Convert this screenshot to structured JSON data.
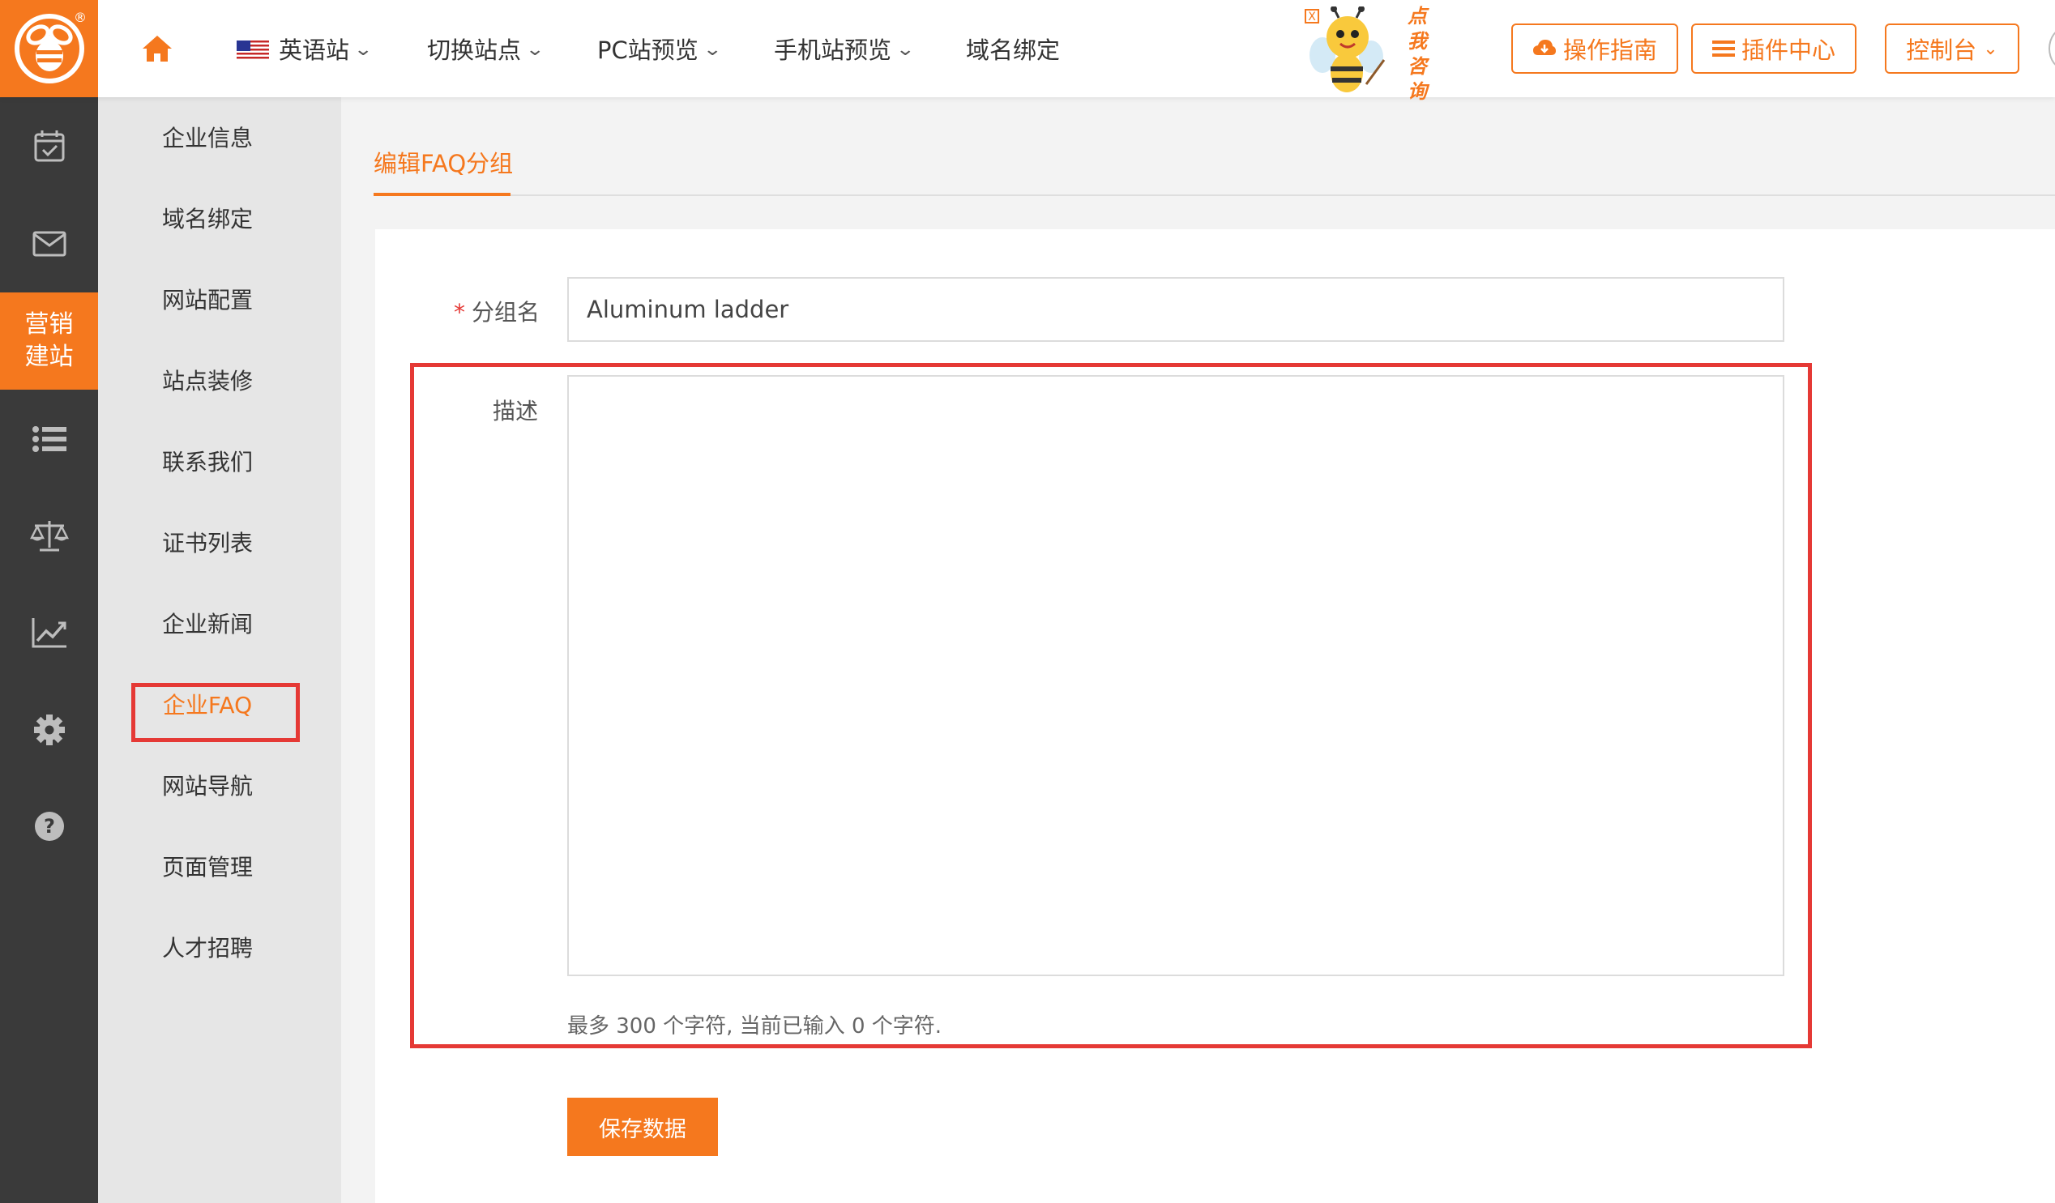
{
  "topbar": {
    "nav": [
      {
        "label": "英语站",
        "has_dropdown": true,
        "flag": "us-flag-icon"
      },
      {
        "label": "切换站点",
        "has_dropdown": true
      },
      {
        "label": "PC站预览",
        "has_dropdown": true
      },
      {
        "label": "手机站预览",
        "has_dropdown": true
      },
      {
        "label": "域名绑定",
        "has_dropdown": false
      }
    ],
    "mascot_text": [
      "点",
      "我",
      "咨",
      "询"
    ],
    "mascot_close": "X",
    "buttons": {
      "guide": "操作指南",
      "plugins": "插件中心",
      "console": "控制台"
    }
  },
  "iconbar": {
    "items": [
      "calendar-check-icon",
      "mail-icon",
      "marketing-site",
      "list-icon",
      "scale-icon",
      "chart-icon",
      "gear-icon",
      "help-icon"
    ],
    "active_label_line1": "营销",
    "active_label_line2": "建站"
  },
  "submenu": {
    "items": [
      {
        "label": "企业信息"
      },
      {
        "label": "域名绑定"
      },
      {
        "label": "网站配置"
      },
      {
        "label": "站点装修"
      },
      {
        "label": "联系我们"
      },
      {
        "label": "证书列表"
      },
      {
        "label": "企业新闻"
      },
      {
        "label": "企业FAQ",
        "active": true
      },
      {
        "label": "网站导航"
      },
      {
        "label": "页面管理"
      },
      {
        "label": "人才招聘"
      }
    ]
  },
  "main": {
    "tab_title": "编辑FAQ分组",
    "form": {
      "group_name_label": "分组名",
      "required_mark": "*",
      "group_name_value": "Aluminum ladder",
      "description_label": "描述",
      "description_value": "",
      "hint": "最多 300 个字符, 当前已输入 0 个字符.",
      "save_label": "保存数据"
    }
  },
  "colors": {
    "accent": "#f5781e",
    "sidebar_dark": "#3a3a3a",
    "highlight": "#e53935"
  }
}
